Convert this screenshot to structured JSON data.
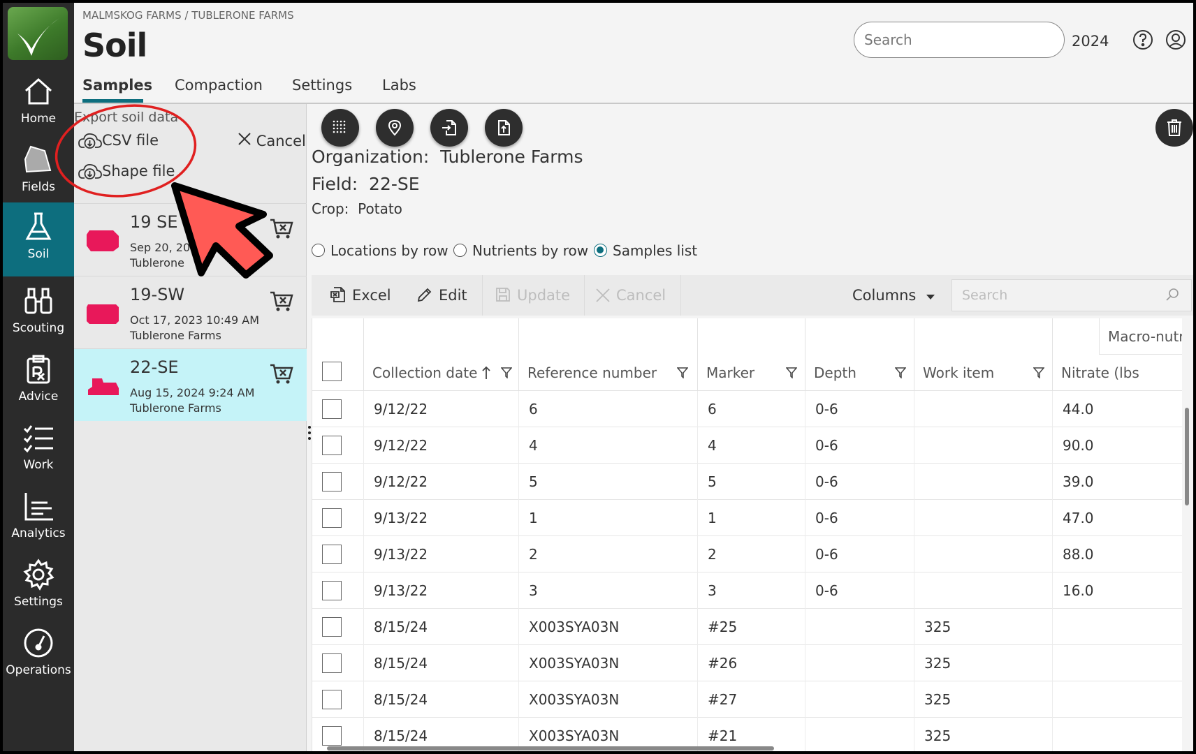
{
  "breadcrumb": "MALMSKOG FARMS / TUBLERONE FARMS",
  "page_title": "Soil",
  "search_placeholder": "Search",
  "year": "2024",
  "nav": [
    {
      "label": "Home",
      "icon": "home-icon"
    },
    {
      "label": "Fields",
      "icon": "fields-icon"
    },
    {
      "label": "Soil",
      "icon": "flask-icon",
      "active": true
    },
    {
      "label": "Scouting",
      "icon": "binoculars-icon"
    },
    {
      "label": "Advice",
      "icon": "prescription-icon"
    },
    {
      "label": "Work",
      "icon": "checklist-icon"
    },
    {
      "label": "Analytics",
      "icon": "chart-icon"
    },
    {
      "label": "Settings",
      "icon": "gear-icon"
    },
    {
      "label": "Operations",
      "icon": "gauge-icon"
    }
  ],
  "tabs": [
    "Samples",
    "Compaction",
    "Settings",
    "Labs"
  ],
  "export": {
    "title": "Export soil data",
    "csv": "CSV file",
    "shape": "Shape file",
    "cancel": "Cancel"
  },
  "fields": [
    {
      "name": "19 SE",
      "date": "Sep 20, 20",
      "org": "Tublerone "
    },
    {
      "name": "19-SW",
      "date": "Oct 17, 2023 10:49 AM",
      "org": "Tublerone Farms"
    },
    {
      "name": "22-SE",
      "date": "Aug 15, 2024 9:24 AM",
      "org": "Tublerone Farms"
    }
  ],
  "details": {
    "org_label": "Organization:",
    "org_value": "Tublerone Farms",
    "field_label": "Field:",
    "field_value": "22-SE",
    "crop_label": "Crop:",
    "crop_value": "Potato"
  },
  "view_options": {
    "locations": "Locations by row",
    "nutrients": "Nutrients by row",
    "samples": "Samples list",
    "selected": "samples"
  },
  "grid_toolbar": {
    "excel": "Excel",
    "edit": "Edit",
    "update": "Update",
    "cancel": "Cancel",
    "columns": "Columns",
    "search_placeholder": "Search"
  },
  "table": {
    "group_header": "Macro-nutr",
    "columns": [
      "Collection date",
      "Reference number",
      "Marker",
      "Depth",
      "Work item",
      "Nitrate (lbs"
    ],
    "rows": [
      [
        "9/12/22",
        "6",
        "6",
        "0-6",
        "",
        "44.0"
      ],
      [
        "9/12/22",
        "4",
        "4",
        "0-6",
        "",
        "90.0"
      ],
      [
        "9/12/22",
        "5",
        "5",
        "0-6",
        "",
        "39.0"
      ],
      [
        "9/13/22",
        "1",
        "1",
        "0-6",
        "",
        "47.0"
      ],
      [
        "9/13/22",
        "2",
        "2",
        "0-6",
        "",
        "88.0"
      ],
      [
        "9/13/22",
        "3",
        "3",
        "0-6",
        "",
        "16.0"
      ],
      [
        "8/15/24",
        "X003SYA03N",
        "#25",
        "",
        "325",
        ""
      ],
      [
        "8/15/24",
        "X003SYA03N",
        "#26",
        "",
        "325",
        ""
      ],
      [
        "8/15/24",
        "X003SYA03N",
        "#27",
        "",
        "325",
        ""
      ],
      [
        "8/15/24",
        "X003SYA03N",
        "#21",
        "",
        "325",
        ""
      ]
    ]
  },
  "colors": {
    "nav_bg": "#2b2b2b",
    "accent": "#0d6e7e",
    "selected_card": "#c5f3f8",
    "field_shape": "#e8185a",
    "annotation_red": "#e02020",
    "annotation_arrow": "#ff5a55"
  }
}
